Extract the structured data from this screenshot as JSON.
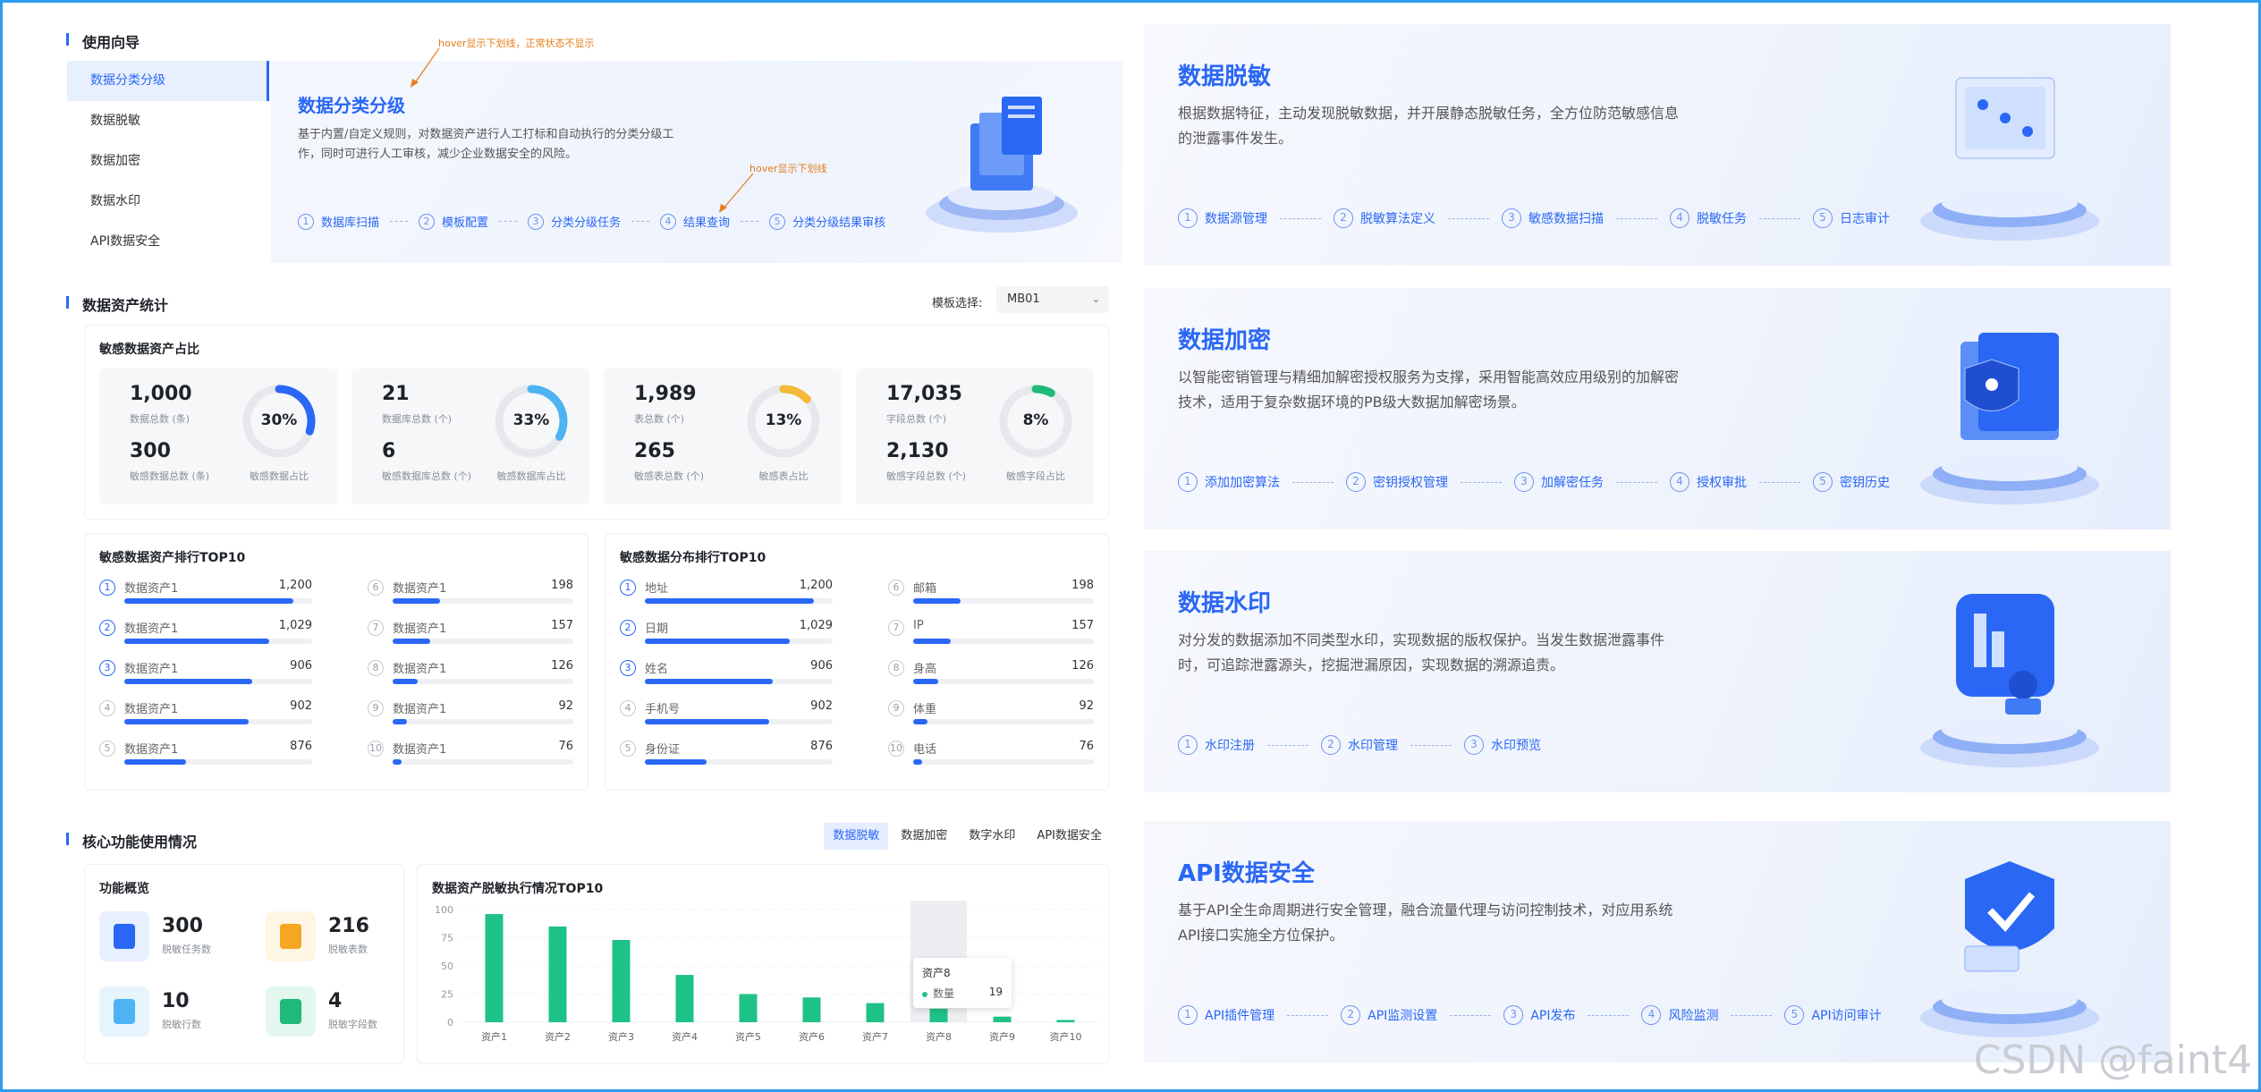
{
  "guide": {
    "title": "使用向导",
    "nav": [
      "数据分类分级",
      "数据脱敏",
      "数据加密",
      "数据水印",
      "API数据安全"
    ],
    "main_title": "数据分类分级",
    "main_desc": "基于内置/自定义规则，对数据资产进行人工打标和自动执行的分类分级工作，同时可进行人工审核，减少企业数据安全的风险。",
    "anno1": "hover显示下划线，正常状态不显示",
    "anno2": "hover显示下划线",
    "steps": [
      "数据库扫描",
      "模板配置",
      "分类分级任务",
      "结果查询",
      "分类分级结果审核"
    ]
  },
  "asset": {
    "title": "数据资产统计",
    "template_label": "模板选择:",
    "template_value": "MB01",
    "ratio_title": "敏感数据资产占比",
    "cards": [
      {
        "total": "1,000",
        "total_label": "数据总数 (条)",
        "sens": "300",
        "sens_label": "敏感数据总数 (条)",
        "pct": "30%",
        "pct_label": "敏感数据占比",
        "ratio": 0.3,
        "color": "#2a67f5"
      },
      {
        "total": "21",
        "total_label": "数据库总数 (个)",
        "sens": "6",
        "sens_label": "敏感数据库总数 (个)",
        "pct": "33%",
        "pct_label": "敏感数据库占比",
        "ratio": 0.33,
        "color": "#4db3f2"
      },
      {
        "total": "1,989",
        "total_label": "表总数 (个)",
        "sens": "265",
        "sens_label": "敏感表总数 (个)",
        "pct": "13%",
        "pct_label": "敏感表占比",
        "ratio": 0.13,
        "color": "#f5b93a"
      },
      {
        "total": "17,035",
        "total_label": "字段总数 (个)",
        "sens": "2,130",
        "sens_label": "敏感字段总数 (个)",
        "pct": "8%",
        "pct_label": "敏感字段占比",
        "ratio": 0.08,
        "color": "#1fb97a"
      }
    ],
    "rank1": {
      "title": "敏感数据资产排行TOP10",
      "items": [
        {
          "n": "1",
          "name": "数据资产1",
          "v": "1,200",
          "r": 0.9
        },
        {
          "n": "2",
          "name": "数据资产1",
          "v": "1,029",
          "r": 0.77
        },
        {
          "n": "3",
          "name": "数据资产1",
          "v": "906",
          "r": 0.68
        },
        {
          "n": "4",
          "name": "数据资产1",
          "v": "902",
          "r": 0.66
        },
        {
          "n": "5",
          "name": "数据资产1",
          "v": "876",
          "r": 0.33
        },
        {
          "n": "6",
          "name": "数据资产1",
          "v": "198",
          "r": 0.26
        },
        {
          "n": "7",
          "name": "数据资产1",
          "v": "157",
          "r": 0.21
        },
        {
          "n": "8",
          "name": "数据资产1",
          "v": "126",
          "r": 0.14
        },
        {
          "n": "9",
          "name": "数据资产1",
          "v": "92",
          "r": 0.08
        },
        {
          "n": "10",
          "name": "数据资产1",
          "v": "76",
          "r": 0.05
        }
      ]
    },
    "rank2": {
      "title": "敏感数据分布排行TOP10",
      "items": [
        {
          "n": "1",
          "name": "地址",
          "v": "1,200",
          "r": 0.9
        },
        {
          "n": "2",
          "name": "日期",
          "v": "1,029",
          "r": 0.77
        },
        {
          "n": "3",
          "name": "姓名",
          "v": "906",
          "r": 0.68
        },
        {
          "n": "4",
          "name": "手机号",
          "v": "902",
          "r": 0.66
        },
        {
          "n": "5",
          "name": "身份证",
          "v": "876",
          "r": 0.33
        },
        {
          "n": "6",
          "name": "邮箱",
          "v": "198",
          "r": 0.26
        },
        {
          "n": "7",
          "name": "IP",
          "v": "157",
          "r": 0.21
        },
        {
          "n": "8",
          "name": "身高",
          "v": "126",
          "r": 0.14
        },
        {
          "n": "9",
          "name": "体重",
          "v": "92",
          "r": 0.08
        },
        {
          "n": "10",
          "name": "电话",
          "v": "76",
          "r": 0.05
        }
      ]
    }
  },
  "core": {
    "title": "核心功能使用情况",
    "tabs": [
      "数据脱敏",
      "数据加密",
      "数字水印",
      "API数据安全"
    ],
    "overview_title": "功能概览",
    "overview": [
      {
        "v": "300",
        "l": "脱敏任务数",
        "bg": "#e8efff",
        "fg": "#2a67f5"
      },
      {
        "v": "216",
        "l": "脱敏表数",
        "bg": "#fff5e3",
        "fg": "#f5a623"
      },
      {
        "v": "10",
        "l": "脱敏行数",
        "bg": "#e6f4fd",
        "fg": "#4db3f2"
      },
      {
        "v": "4",
        "l": "脱敏字段数",
        "bg": "#e3f7ee",
        "fg": "#1fb97a"
      }
    ],
    "chart_title": "数据资产脱敏执行情况TOP10",
    "tooltip_title": "资产8",
    "tooltip_label": "数量",
    "tooltip_value": "19"
  },
  "chart_data": {
    "type": "bar",
    "categories": [
      "资产1",
      "资产2",
      "资产3",
      "资产4",
      "资产5",
      "资产6",
      "资产7",
      "资产8",
      "资产9",
      "资产10"
    ],
    "values": [
      96,
      85,
      73,
      42,
      25,
      22,
      17,
      12,
      5,
      2
    ],
    "yticks": [
      "100",
      "75",
      "50",
      "25",
      "0"
    ],
    "ylim": [
      0,
      100
    ],
    "bar_color": "#1fc286",
    "highlight_index": 7
  },
  "right": [
    {
      "title": "数据脱敏",
      "desc": "根据数据特征，主动发现脱敏数据，并开展静态脱敏任务，全方位防范敏感信息的泄露事件发生。",
      "steps": [
        "数据源管理",
        "脱敏算法定义",
        "敏感数据扫描",
        "脱敏任务",
        "日志审计"
      ]
    },
    {
      "title": "数据加密",
      "desc": "以智能密销管理与精细加解密授权服务为支撑，采用智能高效应用级别的加解密技术，适用于复杂数据环境的PB级大数据加解密场景。",
      "steps": [
        "添加加密算法",
        "密钥授权管理",
        "加解密任务",
        "授权审批",
        "密钥历史"
      ]
    },
    {
      "title": "数据水印",
      "desc": "对分发的数据添加不同类型水印，实现数据的版权保护。当发生数据泄露事件时，可追踪泄露源头，挖掘泄漏原因，实现数据的溯源追责。",
      "steps": [
        "水印注册",
        "水印管理",
        "水印预览"
      ]
    },
    {
      "title": "API数据安全",
      "desc": "基于API全生命周期进行安全管理，融合流量代理与访问控制技术，对应用系统API接口实施全方位保护。",
      "steps": [
        "API插件管理",
        "API监测设置",
        "API发布",
        "风险监测",
        "API访问审计"
      ]
    }
  ],
  "watermark": "CSDN @faint4"
}
